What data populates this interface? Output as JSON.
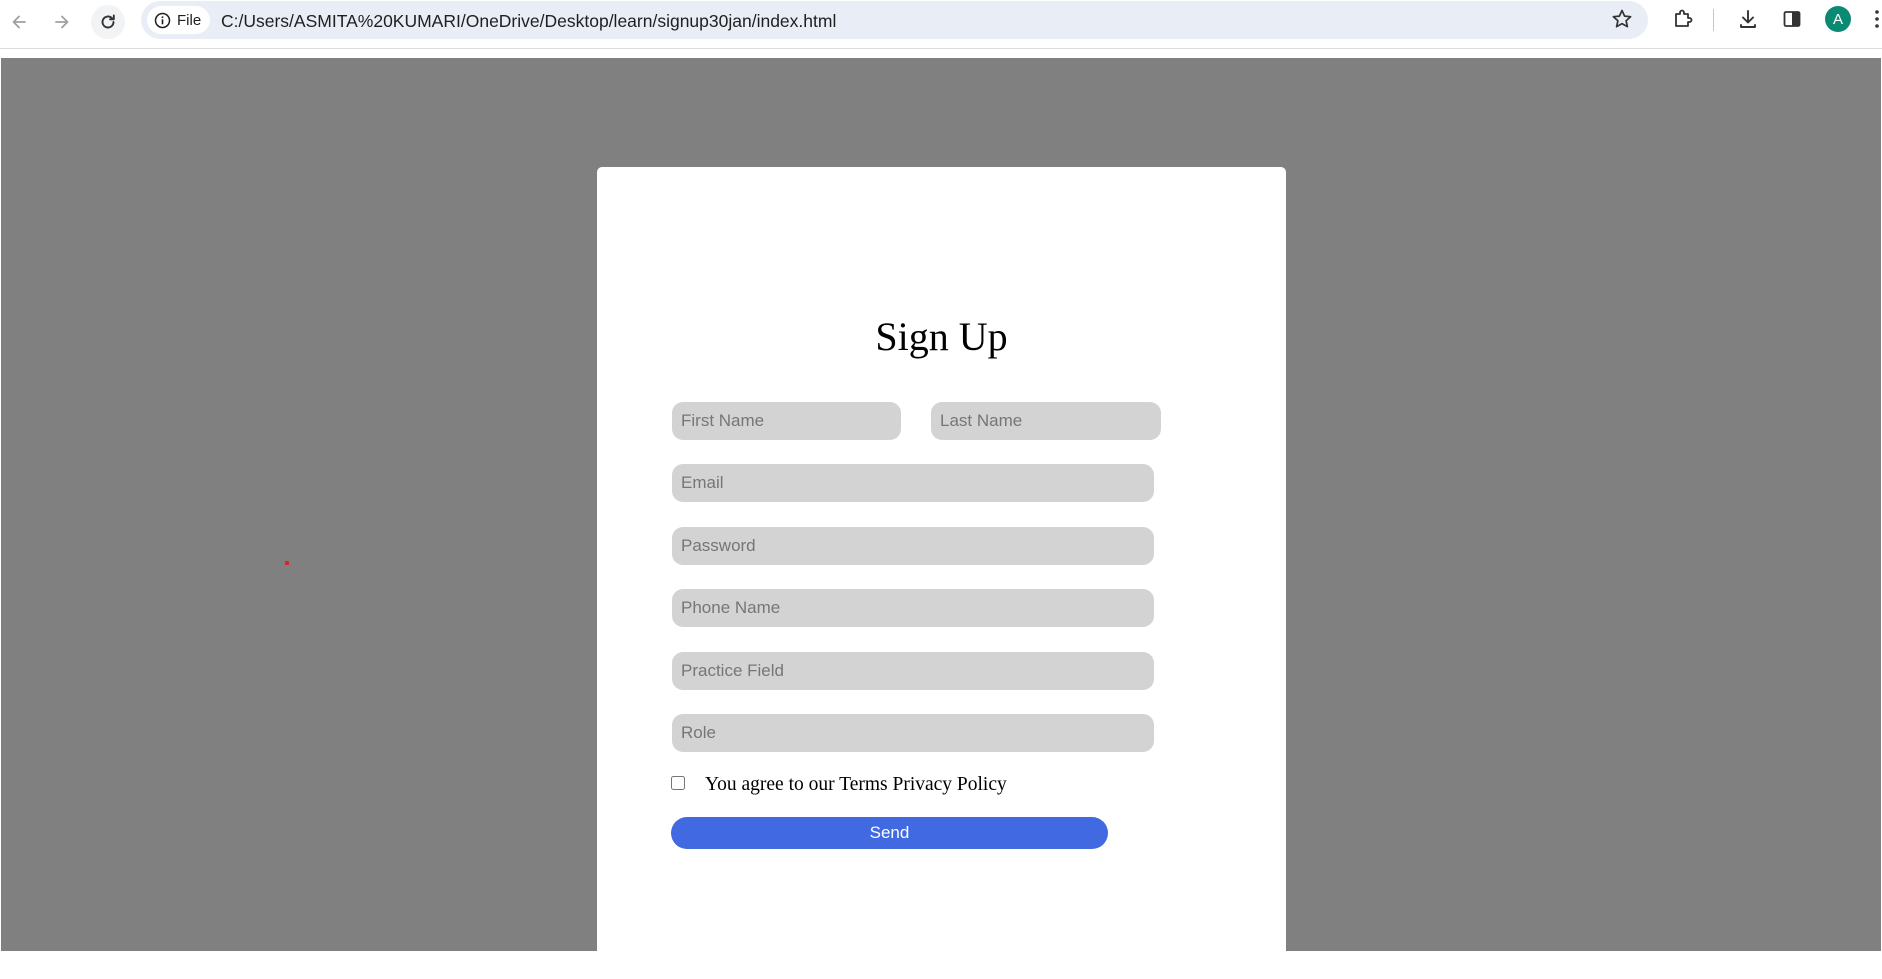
{
  "browser": {
    "site_chip_label": "File",
    "url": "C:/Users/ASMITA%20KUMARI/OneDrive/Desktop/learn/signup30jan/index.html",
    "profile_initial": "A",
    "profile_color": "#0b8a73"
  },
  "page": {
    "background_color": "#808080"
  },
  "form": {
    "title": "Sign Up",
    "fields": {
      "first_name_placeholder": "First Name",
      "last_name_placeholder": "Last Name",
      "email_placeholder": "Email",
      "password_placeholder": "Password",
      "phone_placeholder": "Phone Name",
      "practice_field_placeholder": "Practice Field",
      "role_placeholder": "Role"
    },
    "agree_label": "You agree to our Terms Privacy Policy",
    "agree_checked": false,
    "submit_label": "Send",
    "submit_color": "#4169e1"
  }
}
